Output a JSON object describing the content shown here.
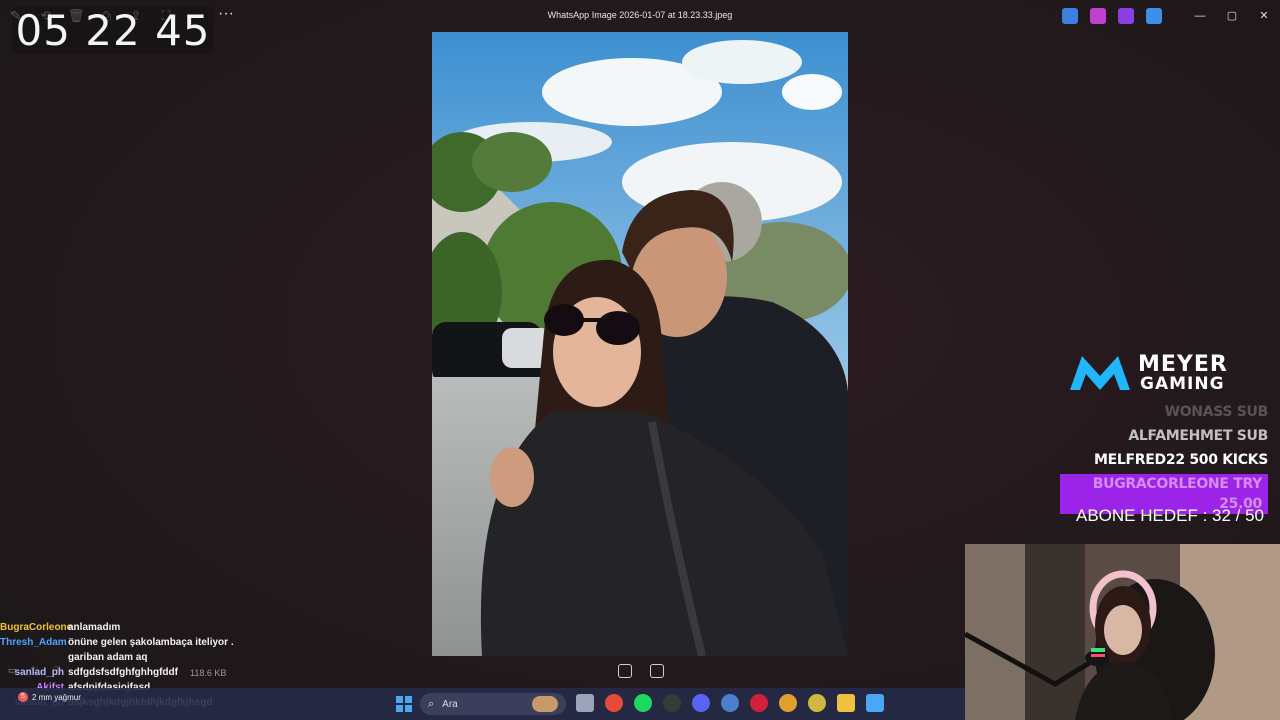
{
  "window": {
    "title": "WhatsApp Image 2026-01-07 at 18.23.33.jpeg",
    "toolbar": [
      {
        "name": "edit-icon"
      },
      {
        "name": "rotate-icon"
      },
      {
        "name": "delete-icon"
      },
      {
        "name": "print-icon"
      },
      {
        "name": "share-icon"
      },
      {
        "name": "fullscreen-icon"
      }
    ],
    "more_label": "···",
    "controls": {
      "minimize": "—",
      "maximize": "▢",
      "close": "✕"
    }
  },
  "tray": {
    "icons": [
      {
        "name": "edge-beta-icon",
        "color": "#3b7fe0"
      },
      {
        "name": "app-pink-icon",
        "color": "#c040d0"
      },
      {
        "name": "app-purple-icon",
        "color": "#8a3fe0"
      },
      {
        "name": "cloud-off-icon",
        "color": "#3a8fe8"
      }
    ]
  },
  "clock": {
    "time": "05 22 45"
  },
  "chat": {
    "messages": [
      {
        "user": "BugraCorleone",
        "color": "#f1c232",
        "text": "anlamadım"
      },
      {
        "user": "Thresh_Adam",
        "color": "#4fa3ff",
        "text": "önüne gelen şakolambaça iteliyor . gariban adam aq"
      },
      {
        "user": "sanlad_ph",
        "color": "#b7b7ff",
        "text": "sdfgdsfsdfghfghhgfddf"
      },
      {
        "user": "Akifst",
        "color": "#c77dff",
        "text": "afsdpjfdasiojfasd"
      },
      {
        "user": "sanlad_ph",
        "color": "#b7b7ff",
        "text": "dsjksghjkdgjhkfdhjkdgfkjhsgd"
      }
    ]
  },
  "viewer": {
    "file_size": "118.6 KB"
  },
  "weather": {
    "badge": "5",
    "text": "2 mm yağmur"
  },
  "taskbar": {
    "search_placeholder": "Ara",
    "apps": [
      {
        "name": "file-explorer-icon",
        "color": "#9aa3b8"
      },
      {
        "name": "chrome-icon",
        "color": "#e84a3a"
      },
      {
        "name": "spotify-icon",
        "color": "#1ed760"
      },
      {
        "name": "obs-icon",
        "color": "#3a3a3a"
      },
      {
        "name": "discord-icon",
        "color": "#5865f2"
      },
      {
        "name": "app-globe-icon",
        "color": "#4a7fd0"
      },
      {
        "name": "app-red-icon",
        "color": "#d0203a"
      },
      {
        "name": "chrome-beta-icon",
        "color": "#e0a030"
      },
      {
        "name": "app-yellow-icon",
        "color": "#d0b840"
      },
      {
        "name": "folder-icon",
        "color": "#f0c040"
      },
      {
        "name": "photos-icon",
        "color": "#4aa7f5"
      }
    ]
  },
  "overlay": {
    "brand_line1": "MEYER",
    "brand_line2": "GAMING",
    "brand_color": "#1fb5ff",
    "events": [
      {
        "text": "WONASS  SUB",
        "style": "faded"
      },
      {
        "text": "ALFAMEHMET  SUB",
        "style": "mid"
      },
      {
        "text": "MELFRED22  500 KICKS",
        "style": "full"
      },
      {
        "text": "BUGRACORLEONE  TRY 25.00",
        "style": "highlight"
      }
    ],
    "sub_goal": "ABONE HEDEF : 32 / 50"
  }
}
